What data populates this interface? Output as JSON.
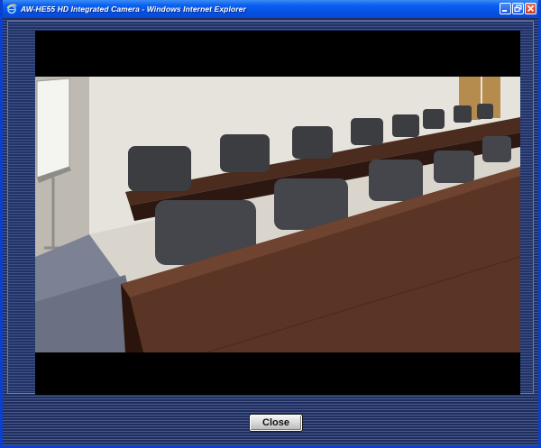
{
  "window": {
    "title": "AW-HE55 HD Integrated Camera - Windows Internet Explorer"
  },
  "dialog": {
    "close_label": "Close"
  },
  "colors": {
    "titlebar": "#0a5ff0",
    "panel_background": "#223466",
    "video_letterbox": "#000000"
  }
}
